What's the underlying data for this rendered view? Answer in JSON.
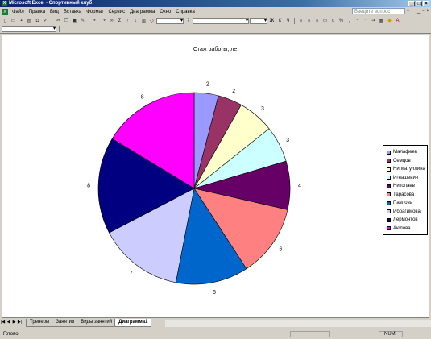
{
  "window": {
    "title": "Microsoft Excel - Спортивный клуб",
    "app_icon": "X"
  },
  "menu": {
    "items": [
      "Файл",
      "Правка",
      "Вид",
      "Вставка",
      "Формат",
      "Сервис",
      "Диаграмма",
      "Окно",
      "Справка"
    ],
    "help_placeholder": "Введите вопрос"
  },
  "sheets": {
    "tabs": [
      "Тренеры",
      "Занятия",
      "Виды занятий",
      "Диаграмма1"
    ],
    "active_index": 3
  },
  "status": {
    "ready": "Готово",
    "num": "NUM"
  },
  "chart_data": {
    "type": "pie",
    "title": "Стаж работы, лет",
    "categories": [
      "Малафеев",
      "Семцов",
      "Нигматуллина",
      "Игнашевич",
      "Николаев",
      "Тарасова",
      "Павлова",
      "Ибрагимова",
      "Лермонтов",
      "Аюпова"
    ],
    "values": [
      2,
      2,
      3,
      3,
      4,
      6,
      6,
      7,
      8,
      8
    ],
    "colors": [
      "#9999ff",
      "#993366",
      "#ffffcc",
      "#ccffff",
      "#660066",
      "#ff8080",
      "#0066cc",
      "#ccccff",
      "#000080",
      "#ff00ff"
    ],
    "data_labels": true,
    "legend": "right"
  }
}
